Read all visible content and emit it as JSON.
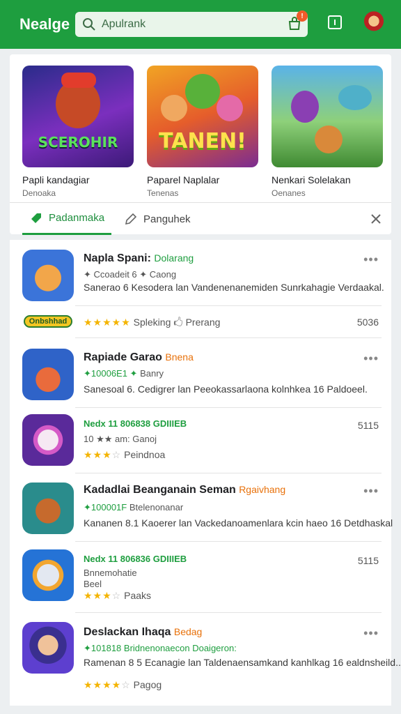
{
  "header": {
    "brand": "Nealge",
    "search_placeholder": "Apulrank",
    "notification_count": "",
    "accent": "#1e9e3f"
  },
  "featured": [
    {
      "title": "Papli kandagiar",
      "subtitle": "Denoaka",
      "logo_text": "SCEROHIR"
    },
    {
      "title": "Paparel Naplalar",
      "subtitle": "Tenenas",
      "logo_text": "TANEN!"
    },
    {
      "title": "Nenkari Solelakan",
      "subtitle": "Oenanes",
      "logo_text": ""
    }
  ],
  "tabs": {
    "active": "Padanmaka",
    "inactive": "Panguhek"
  },
  "apps": [
    {
      "name": "Napla Spani:",
      "tag": "Dolarang",
      "tag_color": "green",
      "meta": "Caong",
      "meta_prefix": "✦ Ccoadeit 6 ✦",
      "desc": "Sanerao 6 Kesodera lan Vandenenanemiden Sunrkahagie Verdaakal.",
      "rating_label": "Spleking",
      "rating_extra": "Prerang",
      "pill": "Onbshhad",
      "stat": "5036"
    },
    {
      "name": "Rapiade Garao",
      "tag": "Bnena",
      "tag_color": "orange",
      "meta": "Banry",
      "meta_prefix": "✦10006E1 ✦",
      "desc": "Sanesoal 6. Cedigrer lan Peeokassarlaona kolnhkea 16 Paldoeel.",
      "stat": ""
    },
    {
      "name": "Nedx 11 806838 GDIIIEB",
      "tag": "",
      "tag_color": "green",
      "meta": "10 ★★ am: Ganoj",
      "rating_label": "Peindnoa",
      "stat": "5115"
    },
    {
      "name": "Kadadlai Beanganain Seman",
      "tag": "Rgaivhang",
      "tag_color": "orange",
      "meta": "Btelenonanar",
      "meta_prefix": "✦100001F",
      "desc": "Kananen 8.1 Kaoerer lan Vackedanoamenlara kcin haeo 16 Detdhaskal",
      "stat": ""
    },
    {
      "name": "Nedx 11 806836 GDIIIEB",
      "tag": "",
      "tag_color": "green",
      "meta": "Bnnemohatie",
      "meta2": "Beel",
      "rating_label": "Paaks",
      "stat": "5115"
    },
    {
      "name": "Deslackan Ihaqa",
      "tag": "Bedag",
      "tag_color": "orange",
      "meta": "Bridnenonaecon Doaigeron:",
      "meta_prefix": "✦101818",
      "desc": "Ramenan 8 5 Ecanagie lan Taldenaensamkand kanhlkag 16 ealdnsheild...",
      "rating_label": "Pagog",
      "stat": ""
    }
  ]
}
